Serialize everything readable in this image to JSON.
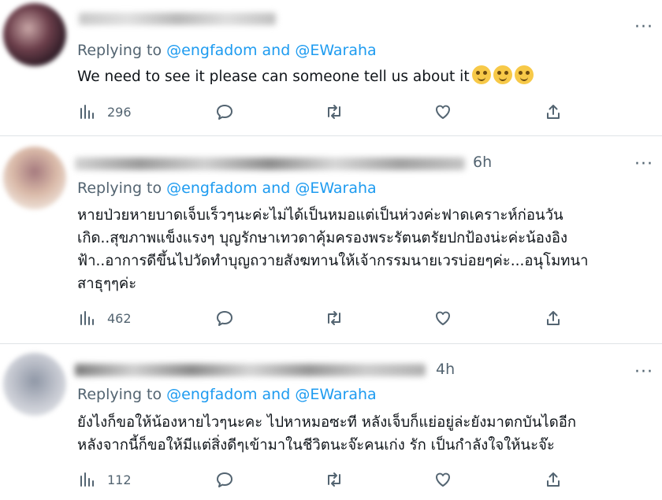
{
  "tweets": [
    {
      "time": "",
      "replying_prefix": "Replying to ",
      "mention1": "@engfadom",
      "and": " and ",
      "mention2": "@EWaraha",
      "text": "We need to see it please can someone tell us about it",
      "emojis": [
        "smiling-face-emoji",
        "smiling-face-emoji",
        "smiling-face-emoji"
      ],
      "views": "296",
      "more": "···"
    },
    {
      "time": "6h",
      "replying_prefix": "Replying to ",
      "mention1": "@engfadom",
      "and": " and ",
      "mention2": "@EWaraha",
      "text": "หายป่วยหายบาดเจ็บเร็วๆนะค่ะไม่ได้เป็นหมอแต่เป็นห่วงค่ะฟาดเคราะห์ก่อนวัน\nเกิด..สุขภาพแข็งแรงๆ บุญรักษาเทวดาคุ้มครองพระรัตนตรัยปกป้องน่ะค่ะน้องอิง\nฟ้า..อาการดีขึ้นไปวัดทำบุญถวายสังฆทานให้เจ้ากรรมนายเวรบ่อยๆค่ะ...อนุโมทนา\nสาธุๆๆค่ะ",
      "views": "462",
      "more": "···"
    },
    {
      "time": "4h",
      "replying_prefix": "Replying to ",
      "mention1": "@engfadom",
      "and": " and ",
      "mention2": "@EWaraha",
      "text": "ยังไงก็ขอให้น้องหายไวๆนะคะ ไปหาหมอซะที หลังเจ็บก็แย่อยู่ล่ะยังมาตกบันไดอีก\nหลังจากนี้ก็ขอให้มีแต่สิ่งดีๆเข้ามาในชีวิตนะจ๊ะคนเก่ง รัก เป็นกำลังใจให้นะจ๊ะ",
      "views": "112",
      "more": "···"
    }
  ],
  "icons": [
    "views-icon",
    "reply-icon",
    "retweet-icon",
    "like-icon",
    "share-icon"
  ],
  "colors": {
    "link": "#1d9bf0",
    "muted": "#536471",
    "text": "#0f1419",
    "divider": "#dfe3e6"
  }
}
